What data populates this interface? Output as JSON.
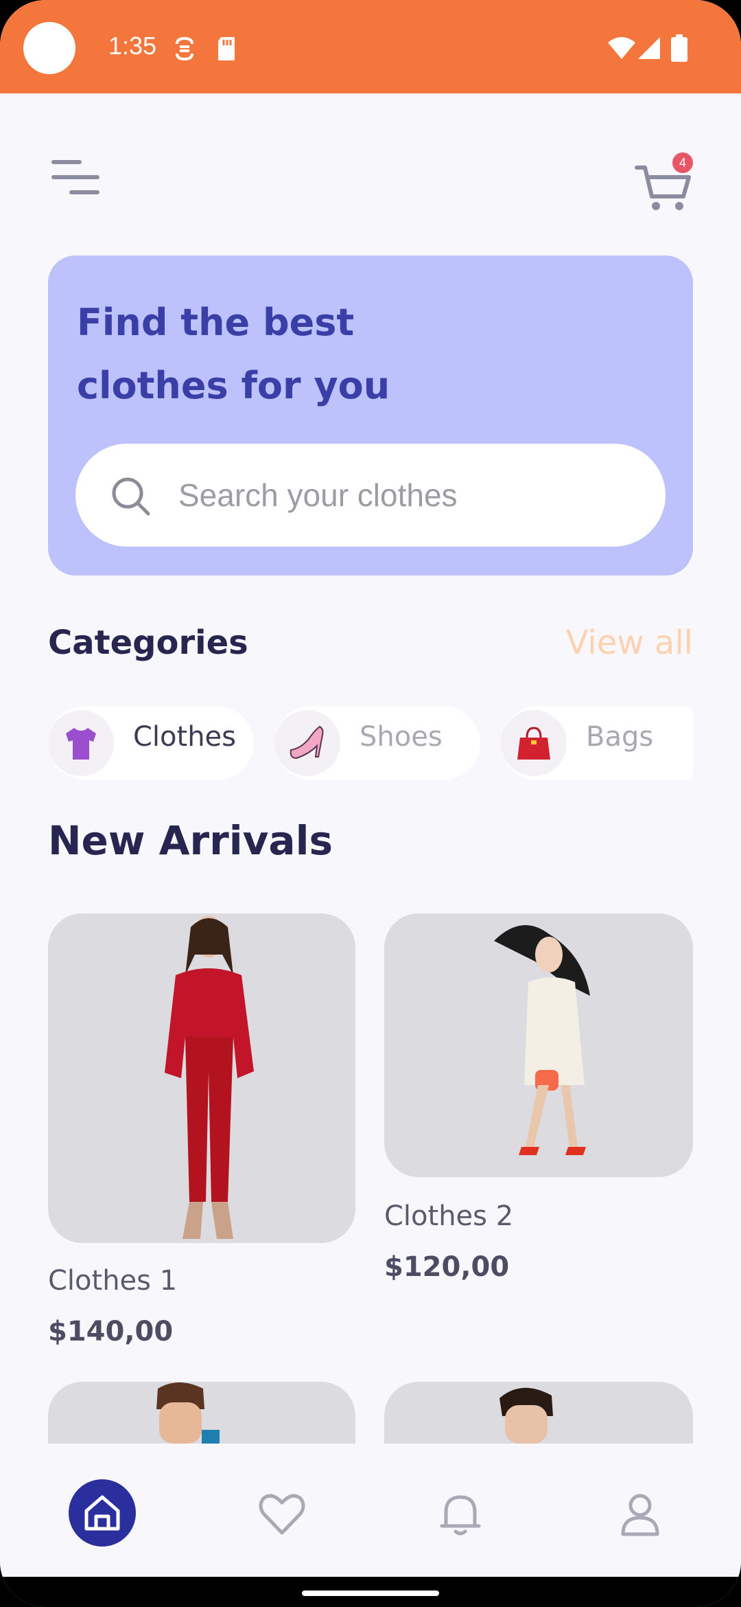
{
  "status_bar": {
    "time": "1:35",
    "background": "#f4763c"
  },
  "header": {
    "menu_icon": "menu-icon",
    "cart_icon": "cart-icon",
    "cart_count": "4"
  },
  "hero": {
    "title_line1": "Find the best",
    "title_line2": "clothes for you",
    "background": "#bdc1fc",
    "search": {
      "placeholder": "Search your clothes",
      "value": ""
    }
  },
  "categories": {
    "title": "Categories",
    "view_all": "View all",
    "items": [
      {
        "label": "Clothes",
        "icon": "tshirt-icon",
        "active": true
      },
      {
        "label": "Shoes",
        "icon": "high-heel-icon",
        "active": false
      },
      {
        "label": "Bags",
        "icon": "handbag-icon",
        "active": false
      }
    ]
  },
  "new_arrivals": {
    "title": "New Arrivals",
    "products": [
      {
        "name": "Clothes 1",
        "price": "$140,00"
      },
      {
        "name": "Clothes 2",
        "price": "$120,00"
      }
    ]
  },
  "bottom_nav": {
    "items": [
      {
        "icon": "home-icon",
        "active": true
      },
      {
        "icon": "heart-icon",
        "active": false
      },
      {
        "icon": "bell-icon",
        "active": false
      },
      {
        "icon": "profile-icon",
        "active": false
      }
    ],
    "active_color": "#2b2f9e"
  }
}
